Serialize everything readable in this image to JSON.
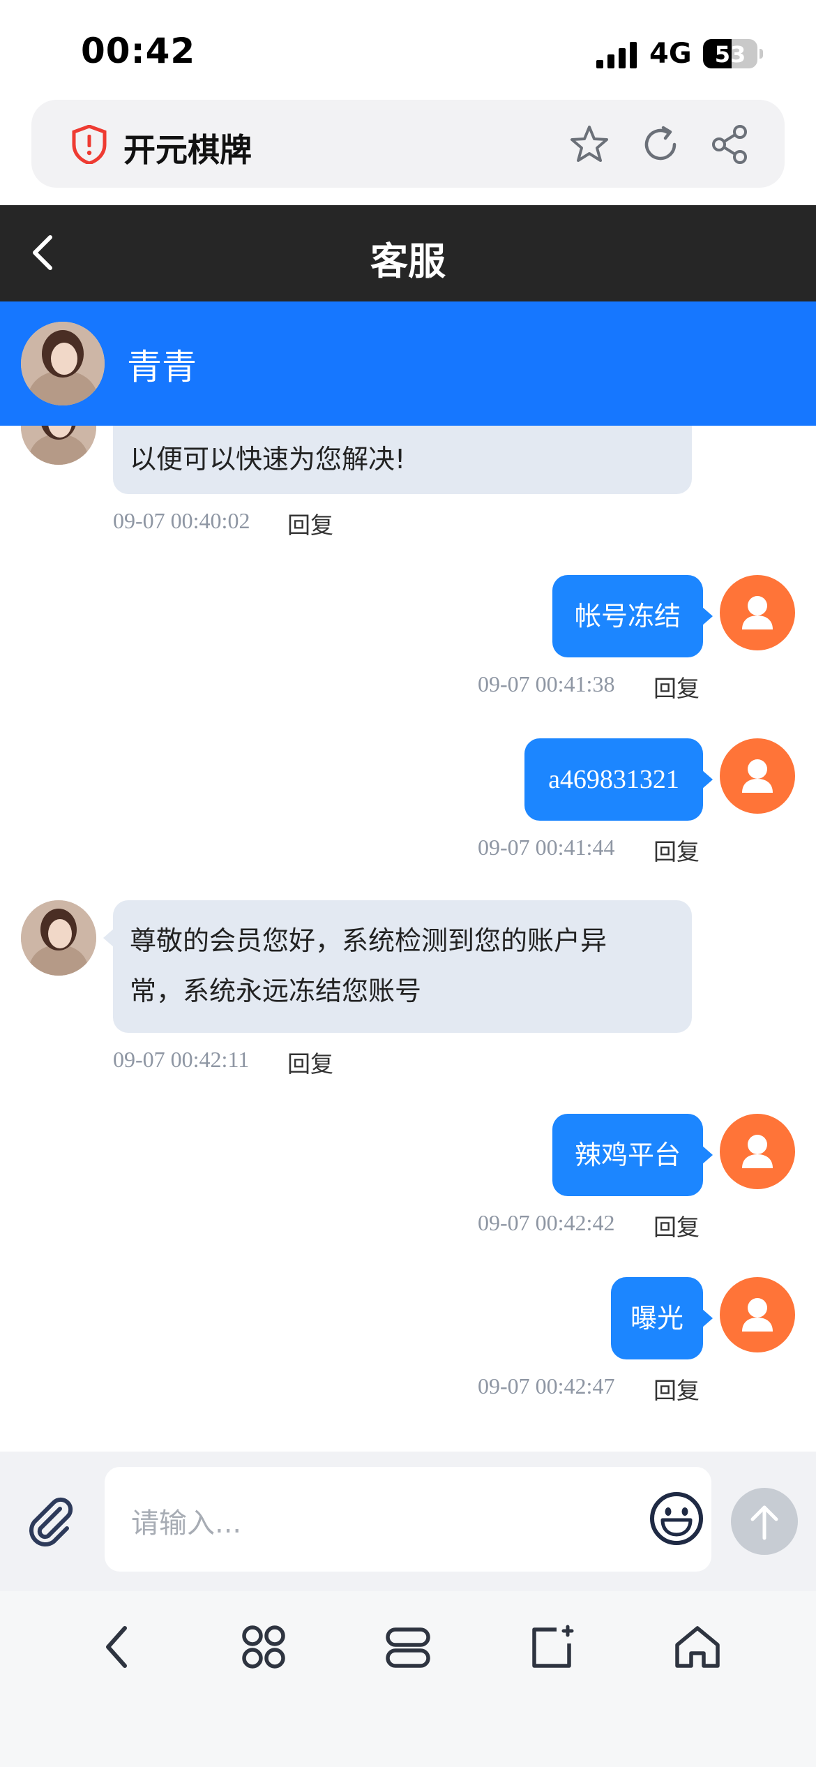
{
  "status_bar": {
    "time": "00:42",
    "network": "4G",
    "battery": "53",
    "battery_level": 0.53
  },
  "browser": {
    "site_title": "开元棋牌"
  },
  "header": {
    "title": "客服"
  },
  "agent": {
    "name": "青青"
  },
  "messages": [
    {
      "side": "agent",
      "text": "以便可以快速为您解决!",
      "time": "09-07 00:40:02",
      "reply": "回复"
    },
    {
      "side": "user",
      "text": "帐号冻结",
      "time": "09-07 00:41:38",
      "reply": "回复"
    },
    {
      "side": "user",
      "text": "a469831321",
      "time": "09-07 00:41:44",
      "reply": "回复"
    },
    {
      "side": "agent",
      "text_line1": "尊敬的会员您好，系统检测到您的账户异",
      "text_line2": "常，系统永远冻结您账号",
      "time": "09-07 00:42:11",
      "reply": "回复"
    },
    {
      "side": "user",
      "text": "辣鸡平台",
      "time": "09-07 00:42:42",
      "reply": "回复"
    },
    {
      "side": "user",
      "text": "曝光",
      "time": "09-07 00:42:47",
      "reply": "回复"
    }
  ],
  "input": {
    "placeholder": "请输入..."
  },
  "colors": {
    "accent": "#1677ff",
    "user_bubble": "#1c86ff",
    "agent_bubble": "#e3e9f2",
    "user_avatar": "#ff7438",
    "header_bg": "#262626"
  },
  "icons": [
    "shield-alert-icon",
    "star-icon",
    "refresh-icon",
    "share-icon",
    "back-icon",
    "person-icon",
    "paperclip-icon",
    "emoji-icon",
    "arrow-up-icon",
    "nav-back-icon",
    "apps-icon",
    "tabs-icon",
    "new-tab-icon",
    "home-icon"
  ]
}
